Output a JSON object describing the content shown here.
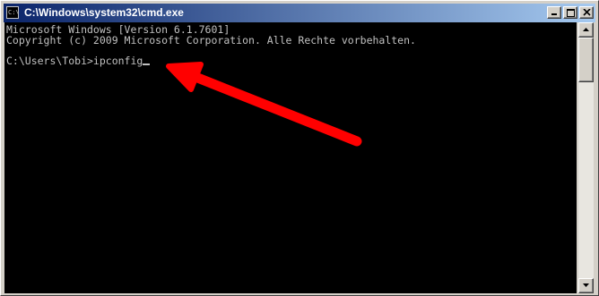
{
  "window": {
    "title": "C:\\Windows\\system32\\cmd.exe",
    "app_icon": "cmd-icon",
    "app_icon_text": "C:\\",
    "controls": [
      "minimize-icon",
      "maximize-icon",
      "close-icon"
    ]
  },
  "console": {
    "lines": [
      "Microsoft Windows [Version 6.1.7601]",
      "Copyright (c) 2009 Microsoft Corporation. Alle Rechte vorbehalten."
    ],
    "prompt": "C:\\Users\\Tobi>ipconfig",
    "text_color": "#c0c0c0",
    "background": "#000000"
  },
  "annotation": {
    "icon": "red-arrow-icon",
    "color": "#ff0000"
  }
}
